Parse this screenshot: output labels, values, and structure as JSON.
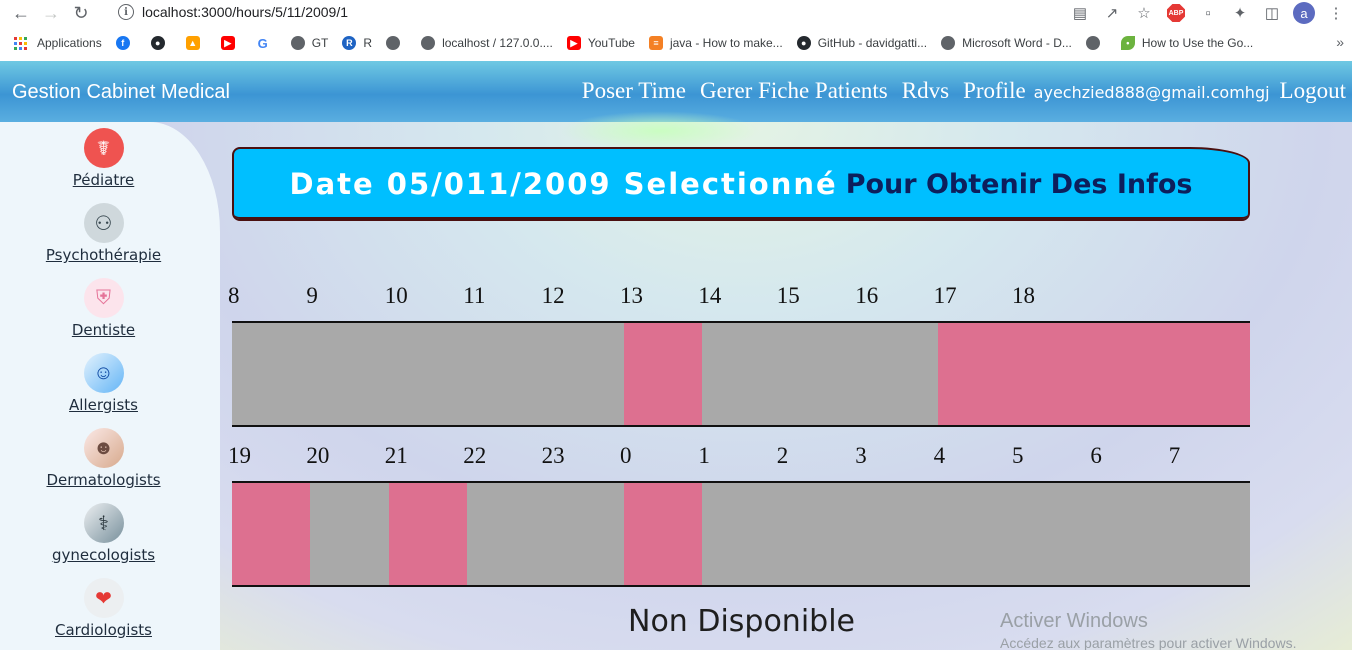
{
  "browser": {
    "url": "localhost:3000/hours/5/11/2009/1",
    "profile_initial": "a",
    "bookmarks": [
      "Applications",
      "GT",
      "R",
      "localhost / 127.0.0....",
      "YouTube",
      "java - How to make...",
      "GitHub - davidgatti...",
      "Microsoft Word - D...",
      "How to Use the Go..."
    ]
  },
  "header": {
    "brand": "Gestion Cabinet Medical",
    "nav": [
      "Poser Time",
      "Gerer Fiche Patients",
      "Rdvs",
      "Profile"
    ],
    "email": "ayechzied888@gmail.comhgj",
    "logout": "Logout"
  },
  "sidebar": {
    "items": [
      {
        "label": "Pédiatre",
        "icon": "doctor-child-icon",
        "color": "#ef5350"
      },
      {
        "label": "Psychothérapie",
        "icon": "therapy-icon",
        "color": "#cfd8dc"
      },
      {
        "label": "Dentiste",
        "icon": "tooth-icon",
        "color": "#f8bbd0"
      },
      {
        "label": "Allergists",
        "icon": "allergist-photo-icon",
        "color": "#90caf9"
      },
      {
        "label": "Dermatologists",
        "icon": "dermatology-photo-icon",
        "color": "#ffccbc"
      },
      {
        "label": "gynecologists",
        "icon": "gynecology-photo-icon",
        "color": "#b0bec5"
      },
      {
        "label": "Cardiologists",
        "icon": "heart-photo-icon",
        "color": "#ef9a9a"
      }
    ]
  },
  "banner": {
    "title": "Date 05/011/2009 Selectionné",
    "subtitle": "Pour Obtenir Des Infos"
  },
  "schedule": {
    "row1_hours": [
      "8",
      "9",
      "10",
      "11",
      "12",
      "13",
      "14",
      "15",
      "16",
      "17",
      "18"
    ],
    "row1_available": [
      false,
      false,
      false,
      false,
      false,
      true,
      false,
      false,
      false,
      true,
      true
    ],
    "row2_hours": [
      "19",
      "20",
      "21",
      "22",
      "23",
      "0",
      "1",
      "2",
      "3",
      "4",
      "5",
      "6",
      "7"
    ],
    "row2_available": [
      true,
      false,
      true,
      false,
      false,
      true,
      false,
      false,
      false,
      false,
      false,
      false,
      false
    ],
    "busy_color": "#a9a9a9",
    "free_color": "#dd7090"
  },
  "status": "Non Disponible",
  "watermark": {
    "line1": "Activer Windows",
    "line2": "Accédez aux paramètres pour activer Windows."
  }
}
